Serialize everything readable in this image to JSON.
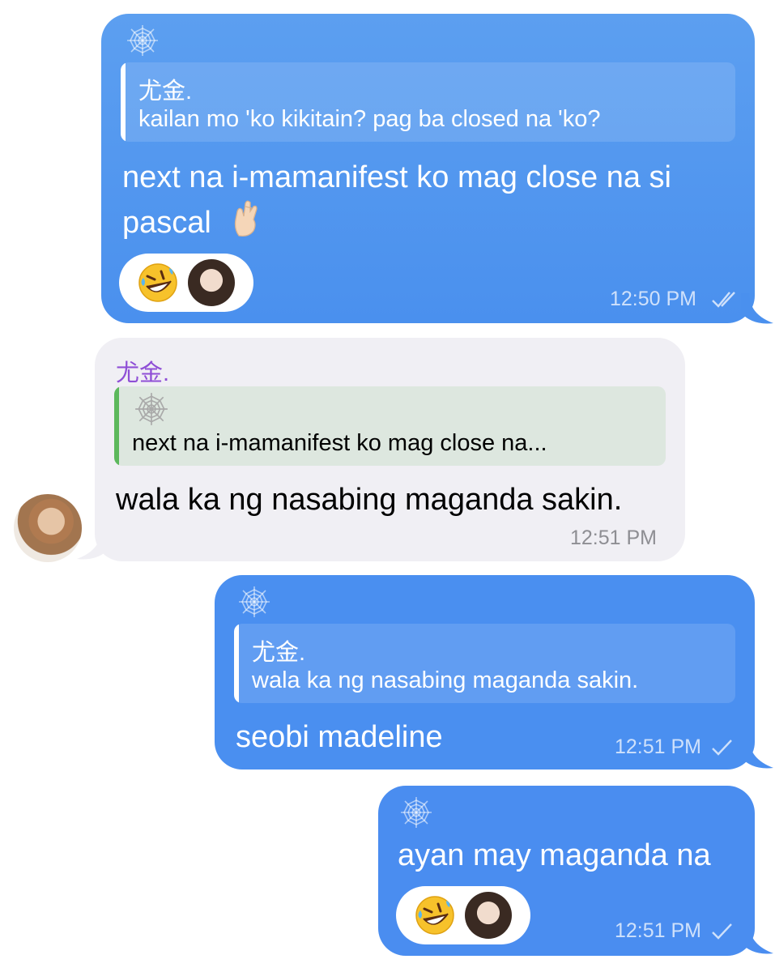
{
  "messages": [
    {
      "direction": "outgoing",
      "reply": {
        "name": "尤金.",
        "text": "kailan mo 'ko kikitain? pag ba closed na 'ko?"
      },
      "text_line1": "next na i-mamanifest ko mag close na si",
      "text_line2": "pascal",
      "emoji": "🤞🏻",
      "reaction": "🤣",
      "time": "12:50 PM",
      "status": "read"
    },
    {
      "direction": "incoming",
      "sender": "尤金.",
      "reply": {
        "text": "next na i-mamanifest ko mag close na..."
      },
      "text": "wala ka ng nasabing maganda sakin.",
      "time": "12:51 PM"
    },
    {
      "direction": "outgoing",
      "reply": {
        "name": "尤金.",
        "text": "wala ka ng nasabing maganda sakin."
      },
      "text": "seobi madeline",
      "time": "12:51 PM",
      "status": "sent"
    },
    {
      "direction": "outgoing",
      "text": "ayan may maganda na",
      "reaction": "🤣",
      "time": "12:51 PM",
      "status": "sent"
    }
  ],
  "colors": {
    "outgoing_bubble": "#4a8ff0",
    "incoming_bubble": "#f0eff4",
    "sender_name": "#8f4fd6",
    "reply_bar_incoming": "#5cb85c"
  },
  "icons": [
    "spiderweb-icon",
    "double-check-icon",
    "check-icon",
    "crossed-fingers-emoji",
    "rofl-emoji"
  ]
}
